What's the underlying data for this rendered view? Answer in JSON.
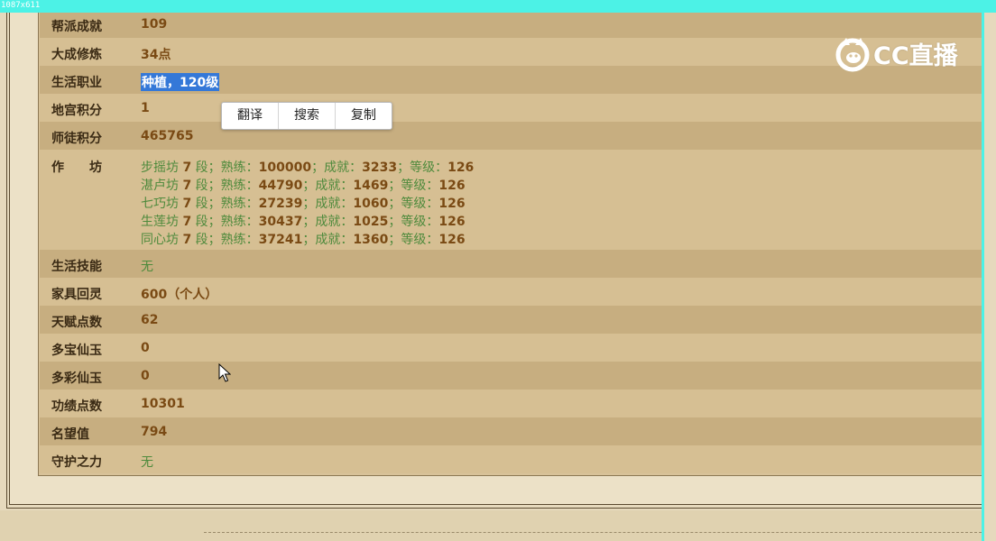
{
  "capture": {
    "size_label": "1087x611",
    "frame_color": "#4cf2e6"
  },
  "logo": {
    "text": "CC直播",
    "icon": "cc-fox-logo-icon"
  },
  "context_menu": {
    "items": [
      "翻译",
      "搜索",
      "复制"
    ]
  },
  "rows": [
    {
      "label": "帮派成就",
      "value": "109"
    },
    {
      "label": "大成修炼",
      "value": "34点"
    },
    {
      "label": "生活职业",
      "value": "种植，120级",
      "selected": true
    },
    {
      "label": "地宫积分",
      "value": "1"
    },
    {
      "label": "师徒积分",
      "value": "465765"
    },
    {
      "label": "作坊",
      "value": ""
    },
    {
      "label": "生活技能",
      "value": "无"
    },
    {
      "label": "家具回灵",
      "value": "600（个人）"
    },
    {
      "label": "天赋点数",
      "value": "62"
    },
    {
      "label": "多宝仙玉",
      "value": "0"
    },
    {
      "label": "多彩仙玉",
      "value": "0"
    },
    {
      "label": "功绩点数",
      "value": "10301"
    },
    {
      "label": "名望值",
      "value": "794"
    },
    {
      "label": "守护之力",
      "value": "无"
    }
  ],
  "workshops": [
    {
      "name": "步摇坊",
      "level": "7",
      "duan": "段",
      "shulian_label": "熟练：",
      "shulian": "100000",
      "chengjiu_label": "成就：",
      "chengjiu": "3233",
      "dengji_label": "等级：",
      "dengji": "126"
    },
    {
      "name": "湛卢坊",
      "level": "7",
      "duan": "段",
      "shulian_label": "熟练：",
      "shulian": "44790",
      "chengjiu_label": "成就：",
      "chengjiu": "1469",
      "dengji_label": "等级：",
      "dengji": "126"
    },
    {
      "name": "七巧坊",
      "level": "7",
      "duan": "段",
      "shulian_label": "熟练：",
      "shulian": "27239",
      "chengjiu_label": "成就：",
      "chengjiu": "1060",
      "dengji_label": "等级：",
      "dengji": "126"
    },
    {
      "name": "生莲坊",
      "level": "7",
      "duan": "段",
      "shulian_label": "熟练：",
      "shulian": "30437",
      "chengjiu_label": "成就：",
      "chengjiu": "1025",
      "dengji_label": "等级：",
      "dengji": "126"
    },
    {
      "name": "同心坊",
      "level": "7",
      "duan": "段",
      "shulian_label": "熟练：",
      "shulian": "37241",
      "chengjiu_label": "成就：",
      "chengjiu": "1360",
      "dengji_label": "等级：",
      "dengji": "126"
    }
  ]
}
